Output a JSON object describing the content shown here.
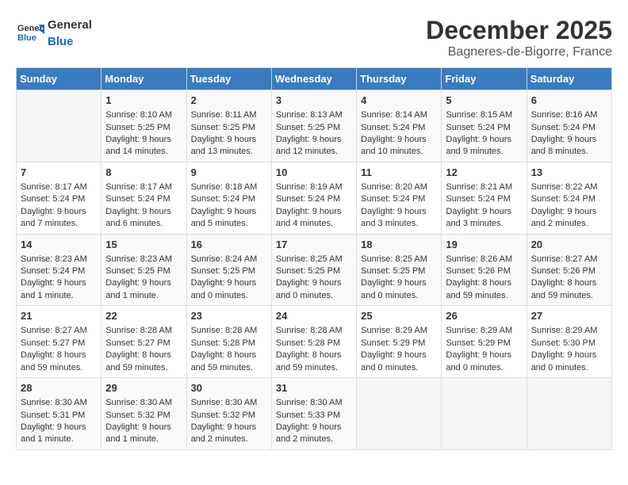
{
  "header": {
    "logo_general": "General",
    "logo_blue": "Blue",
    "month_title": "December 2025",
    "location": "Bagneres-de-Bigorre, France"
  },
  "weekdays": [
    "Sunday",
    "Monday",
    "Tuesday",
    "Wednesday",
    "Thursday",
    "Friday",
    "Saturday"
  ],
  "rows": [
    [
      {
        "day": "",
        "lines": []
      },
      {
        "day": "1",
        "lines": [
          "Sunrise: 8:10 AM",
          "Sunset: 5:25 PM",
          "Daylight: 9 hours",
          "and 14 minutes."
        ]
      },
      {
        "day": "2",
        "lines": [
          "Sunrise: 8:11 AM",
          "Sunset: 5:25 PM",
          "Daylight: 9 hours",
          "and 13 minutes."
        ]
      },
      {
        "day": "3",
        "lines": [
          "Sunrise: 8:13 AM",
          "Sunset: 5:25 PM",
          "Daylight: 9 hours",
          "and 12 minutes."
        ]
      },
      {
        "day": "4",
        "lines": [
          "Sunrise: 8:14 AM",
          "Sunset: 5:24 PM",
          "Daylight: 9 hours",
          "and 10 minutes."
        ]
      },
      {
        "day": "5",
        "lines": [
          "Sunrise: 8:15 AM",
          "Sunset: 5:24 PM",
          "Daylight: 9 hours",
          "and 9 minutes."
        ]
      },
      {
        "day": "6",
        "lines": [
          "Sunrise: 8:16 AM",
          "Sunset: 5:24 PM",
          "Daylight: 9 hours",
          "and 8 minutes."
        ]
      }
    ],
    [
      {
        "day": "7",
        "lines": [
          "Sunrise: 8:17 AM",
          "Sunset: 5:24 PM",
          "Daylight: 9 hours",
          "and 7 minutes."
        ]
      },
      {
        "day": "8",
        "lines": [
          "Sunrise: 8:17 AM",
          "Sunset: 5:24 PM",
          "Daylight: 9 hours",
          "and 6 minutes."
        ]
      },
      {
        "day": "9",
        "lines": [
          "Sunrise: 8:18 AM",
          "Sunset: 5:24 PM",
          "Daylight: 9 hours",
          "and 5 minutes."
        ]
      },
      {
        "day": "10",
        "lines": [
          "Sunrise: 8:19 AM",
          "Sunset: 5:24 PM",
          "Daylight: 9 hours",
          "and 4 minutes."
        ]
      },
      {
        "day": "11",
        "lines": [
          "Sunrise: 8:20 AM",
          "Sunset: 5:24 PM",
          "Daylight: 9 hours",
          "and 3 minutes."
        ]
      },
      {
        "day": "12",
        "lines": [
          "Sunrise: 8:21 AM",
          "Sunset: 5:24 PM",
          "Daylight: 9 hours",
          "and 3 minutes."
        ]
      },
      {
        "day": "13",
        "lines": [
          "Sunrise: 8:22 AM",
          "Sunset: 5:24 PM",
          "Daylight: 9 hours",
          "and 2 minutes."
        ]
      }
    ],
    [
      {
        "day": "14",
        "lines": [
          "Sunrise: 8:23 AM",
          "Sunset: 5:24 PM",
          "Daylight: 9 hours",
          "and 1 minute."
        ]
      },
      {
        "day": "15",
        "lines": [
          "Sunrise: 8:23 AM",
          "Sunset: 5:25 PM",
          "Daylight: 9 hours",
          "and 1 minute."
        ]
      },
      {
        "day": "16",
        "lines": [
          "Sunrise: 8:24 AM",
          "Sunset: 5:25 PM",
          "Daylight: 9 hours",
          "and 0 minutes."
        ]
      },
      {
        "day": "17",
        "lines": [
          "Sunrise: 8:25 AM",
          "Sunset: 5:25 PM",
          "Daylight: 9 hours",
          "and 0 minutes."
        ]
      },
      {
        "day": "18",
        "lines": [
          "Sunrise: 8:25 AM",
          "Sunset: 5:25 PM",
          "Daylight: 9 hours",
          "and 0 minutes."
        ]
      },
      {
        "day": "19",
        "lines": [
          "Sunrise: 8:26 AM",
          "Sunset: 5:26 PM",
          "Daylight: 8 hours",
          "and 59 minutes."
        ]
      },
      {
        "day": "20",
        "lines": [
          "Sunrise: 8:27 AM",
          "Sunset: 5:26 PM",
          "Daylight: 8 hours",
          "and 59 minutes."
        ]
      }
    ],
    [
      {
        "day": "21",
        "lines": [
          "Sunrise: 8:27 AM",
          "Sunset: 5:27 PM",
          "Daylight: 8 hours",
          "and 59 minutes."
        ]
      },
      {
        "day": "22",
        "lines": [
          "Sunrise: 8:28 AM",
          "Sunset: 5:27 PM",
          "Daylight: 8 hours",
          "and 59 minutes."
        ]
      },
      {
        "day": "23",
        "lines": [
          "Sunrise: 8:28 AM",
          "Sunset: 5:28 PM",
          "Daylight: 8 hours",
          "and 59 minutes."
        ]
      },
      {
        "day": "24",
        "lines": [
          "Sunrise: 8:28 AM",
          "Sunset: 5:28 PM",
          "Daylight: 8 hours",
          "and 59 minutes."
        ]
      },
      {
        "day": "25",
        "lines": [
          "Sunrise: 8:29 AM",
          "Sunset: 5:29 PM",
          "Daylight: 9 hours",
          "and 0 minutes."
        ]
      },
      {
        "day": "26",
        "lines": [
          "Sunrise: 8:29 AM",
          "Sunset: 5:29 PM",
          "Daylight: 9 hours",
          "and 0 minutes."
        ]
      },
      {
        "day": "27",
        "lines": [
          "Sunrise: 8:29 AM",
          "Sunset: 5:30 PM",
          "Daylight: 9 hours",
          "and 0 minutes."
        ]
      }
    ],
    [
      {
        "day": "28",
        "lines": [
          "Sunrise: 8:30 AM",
          "Sunset: 5:31 PM",
          "Daylight: 9 hours",
          "and 1 minute."
        ]
      },
      {
        "day": "29",
        "lines": [
          "Sunrise: 8:30 AM",
          "Sunset: 5:32 PM",
          "Daylight: 9 hours",
          "and 1 minute."
        ]
      },
      {
        "day": "30",
        "lines": [
          "Sunrise: 8:30 AM",
          "Sunset: 5:32 PM",
          "Daylight: 9 hours",
          "and 2 minutes."
        ]
      },
      {
        "day": "31",
        "lines": [
          "Sunrise: 8:30 AM",
          "Sunset: 5:33 PM",
          "Daylight: 9 hours",
          "and 2 minutes."
        ]
      },
      {
        "day": "",
        "lines": []
      },
      {
        "day": "",
        "lines": []
      },
      {
        "day": "",
        "lines": []
      }
    ]
  ]
}
